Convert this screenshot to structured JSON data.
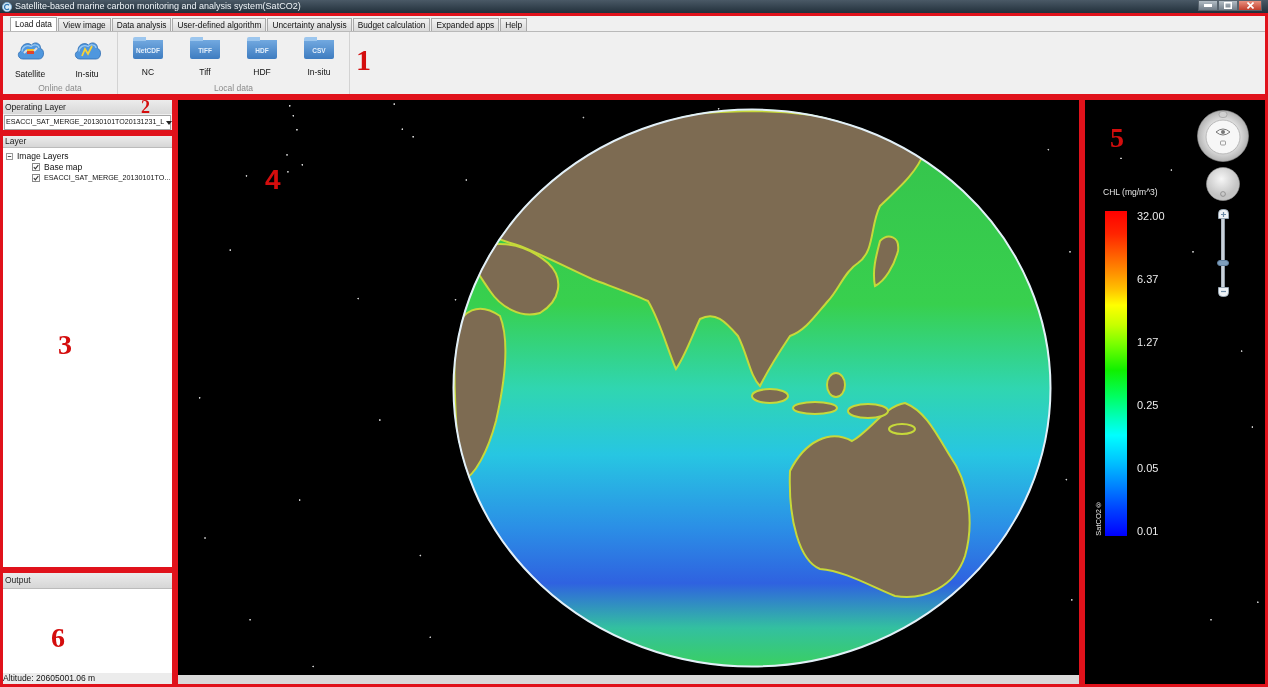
{
  "window": {
    "title": "Satellite-based marine carbon monitoring and analysis system(SatCO2)"
  },
  "ribbon": {
    "marker": "1",
    "tabs": [
      {
        "label": "Load data",
        "selected": true
      },
      {
        "label": "View image",
        "selected": false
      },
      {
        "label": "Data analysis",
        "selected": false
      },
      {
        "label": "User-defined algorithm",
        "selected": false
      },
      {
        "label": "Uncertainty analysis",
        "selected": false
      },
      {
        "label": "Budget calculation",
        "selected": false
      },
      {
        "label": "Expanded apps",
        "selected": false
      },
      {
        "label": "Help",
        "selected": false
      }
    ],
    "groups": [
      {
        "label": "Online data",
        "buttons": [
          {
            "label": "Satellite",
            "kind": "satellite"
          },
          {
            "label": "In-situ",
            "kind": "sensor"
          }
        ]
      },
      {
        "label": "Local data",
        "buttons": [
          {
            "label": "NC",
            "kind": "file",
            "tag": "NetCDF"
          },
          {
            "label": "Tiff",
            "kind": "file",
            "tag": "TIFF"
          },
          {
            "label": "HDF",
            "kind": "file",
            "tag": "HDF"
          },
          {
            "label": "In-situ",
            "kind": "file",
            "tag": "CSV"
          }
        ]
      }
    ]
  },
  "operating_layer": {
    "marker": "2",
    "title": "Operating Layer",
    "value": "ESACCI_SAT_MERGE_20130101TO20131231_L"
  },
  "layers": {
    "marker": "3",
    "title": "Layer",
    "tree": [
      {
        "label": "Image Layers",
        "expanded": true,
        "children": [
          {
            "label": "Base map",
            "checked": true
          },
          {
            "label": "ESACCI_SAT_MERGE_20130101TO...",
            "checked": true
          }
        ]
      }
    ]
  },
  "viewer": {
    "marker": "4"
  },
  "legend": {
    "marker": "5",
    "title": "CHL (mg/m^3)",
    "labels": [
      "32.00",
      "6.37",
      "1.27",
      "0.25",
      "0.05",
      "0.01"
    ],
    "credit": "SatCO2®",
    "zoom_slider": {
      "level": 0.35
    }
  },
  "output": {
    "marker": "6",
    "title": "Output",
    "status": "Altitude: 20605001.06 m"
  }
}
